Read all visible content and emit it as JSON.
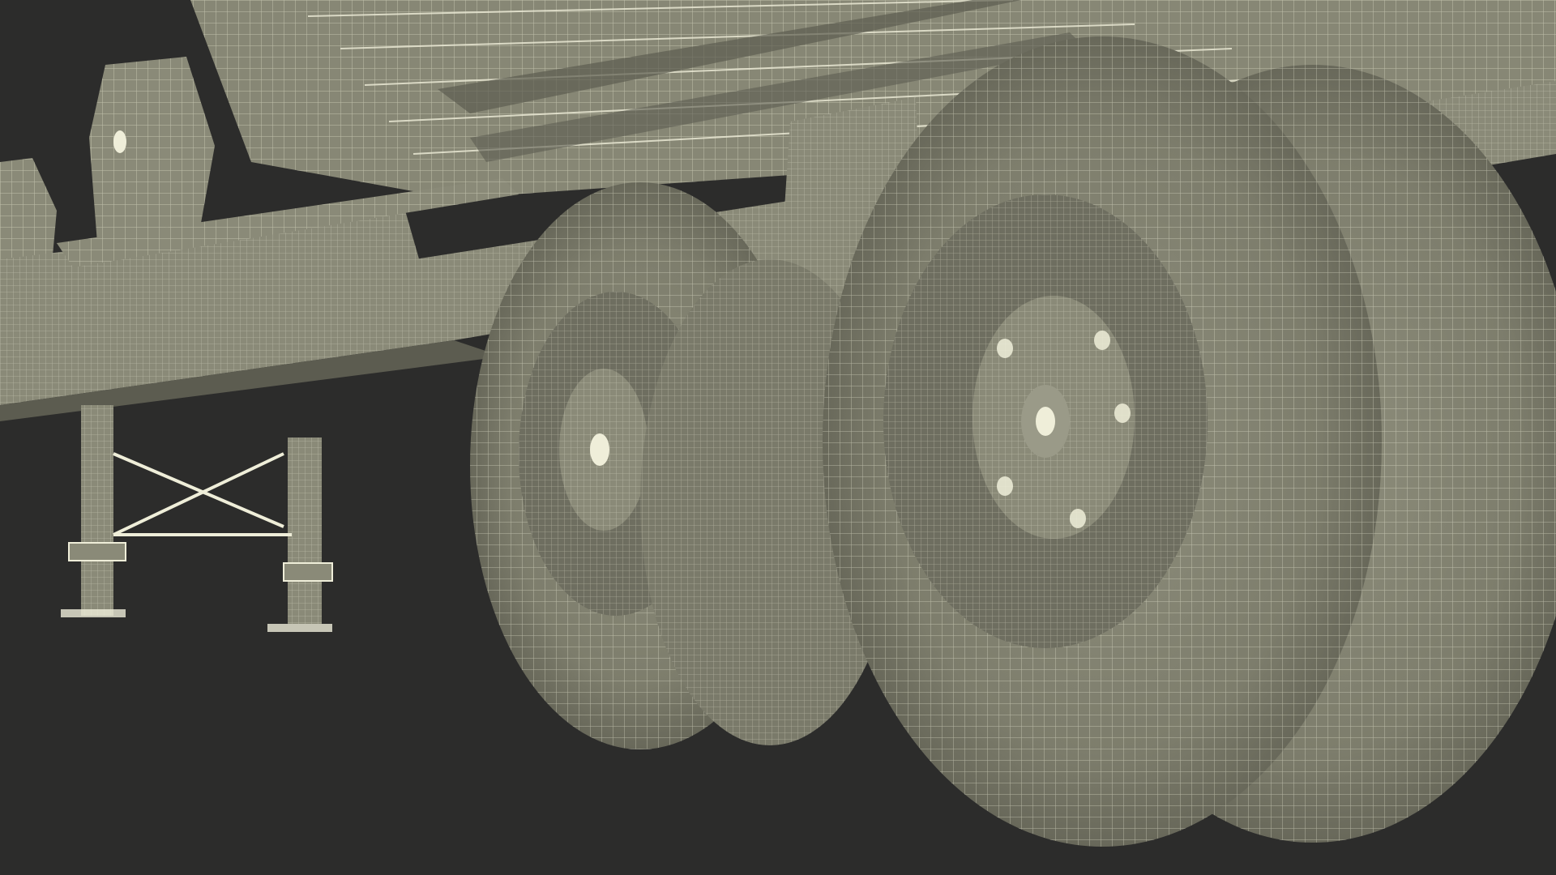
{
  "scene": {
    "subject": "semi-trailer-chassis-wireframe-render",
    "background_color": "#2c2c2b",
    "surface_color": "#8a8a78",
    "wire_color": "#efeed9",
    "shadow_color": "#5c5c50",
    "dark_rim_color": "#6e6e60",
    "icons": {
      "landing-gear": "landing-gear-icon",
      "wheel": "wheel-icon"
    }
  }
}
